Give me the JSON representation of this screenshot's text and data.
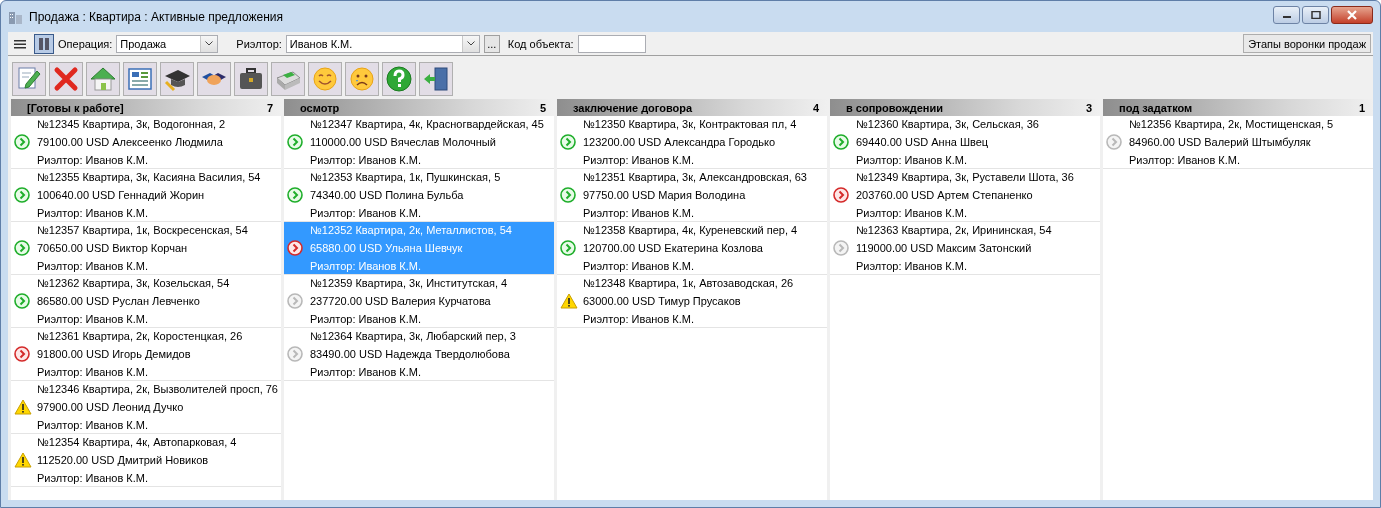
{
  "window": {
    "title": "Продажа : Квартира : Активные предложения"
  },
  "view_toggle": [
    {
      "kind": "list",
      "selected": false
    },
    {
      "kind": "columns",
      "selected": true
    }
  ],
  "filters": {
    "operation_label": "Операция:",
    "operation_value": "Продажа",
    "realtor_label": "Риэлтор:",
    "realtor_value": "Иванов К.М.",
    "browse_button": "...",
    "code_label": "Код объекта:"
  },
  "funnel_button": "Этапы воронки продаж",
  "toolbar": [
    {
      "kind": "edit"
    },
    {
      "kind": "delete"
    },
    {
      "kind": "home"
    },
    {
      "kind": "form"
    },
    {
      "kind": "cap"
    },
    {
      "kind": "handshake"
    },
    {
      "kind": "briefcase"
    },
    {
      "kind": "printer"
    },
    {
      "kind": "smile"
    },
    {
      "kind": "sad"
    },
    {
      "kind": "help"
    },
    {
      "kind": "exit"
    }
  ],
  "columns": [
    {
      "title": "[Готовы к работе]",
      "count": "7",
      "cards": [
        {
          "kind": "go",
          "selected": false,
          "lines": [
            "№12345 Квартира, 3к, Водогонная, 2",
            "79100.00 USD Алексеенко Людмила",
            "Риэлтор: Иванов К.М."
          ]
        },
        {
          "kind": "go",
          "selected": false,
          "lines": [
            "№12355 Квартира, 3к, Касияна Василия, 54",
            "100640.00 USD Геннадий Жорин",
            "Риэлтор: Иванов К.М."
          ]
        },
        {
          "kind": "go",
          "selected": false,
          "lines": [
            "№12357 Квартира, 1к, Воскресенская, 54",
            "70650.00 USD Виктор Корчан",
            "Риэлтор: Иванов К.М."
          ]
        },
        {
          "kind": "go",
          "selected": false,
          "lines": [
            "№12362 Квартира, 3к, Козельская, 54",
            "86580.00 USD Руслан Левченко",
            "Риэлтор: Иванов К.М."
          ]
        },
        {
          "kind": "stop",
          "selected": false,
          "lines": [
            "№12361 Квартира, 2к, Коростенцкая, 26",
            "91800.00 USD Игорь Демидов",
            "Риэлтор: Иванов К.М."
          ]
        },
        {
          "kind": "warn",
          "selected": false,
          "lines": [
            "№12346 Квартира, 2к, Вызволителей просп, 76",
            "97900.00 USD Леонид Дучко",
            "Риэлтор: Иванов К.М."
          ]
        },
        {
          "kind": "warn",
          "selected": false,
          "lines": [
            "№12354 Квартира, 4к, Автопарковая, 4",
            "112520.00 USD Дмитрий Новиков",
            "Риэлтор: Иванов К.М."
          ]
        }
      ]
    },
    {
      "title": "осмотр",
      "count": "5",
      "cards": [
        {
          "kind": "go",
          "selected": false,
          "lines": [
            "№12347 Квартира, 4к, Красногвардейская, 45",
            "110000.00 USD Вячеслав Молочный",
            "Риэлтор: Иванов К.М."
          ]
        },
        {
          "kind": "go",
          "selected": false,
          "lines": [
            "№12353 Квартира, 1к, Пушкинская, 5",
            "74340.00 USD Полина Бульба",
            "Риэлтор: Иванов К.М."
          ]
        },
        {
          "kind": "stop",
          "selected": true,
          "lines": [
            "№12352 Квартира, 2к, Металлистов, 54",
            "65880.00 USD Ульяна Шевчук",
            "Риэлтор: Иванов К.М."
          ]
        },
        {
          "kind": "idle",
          "selected": false,
          "lines": [
            "№12359 Квартира, 3к, Институтская, 4",
            "237720.00 USD Валерия Курчатова",
            "Риэлтор: Иванов К.М."
          ]
        },
        {
          "kind": "idle",
          "selected": false,
          "lines": [
            "№12364 Квартира, 3к, Любарский пер, 3",
            "83490.00 USD Надежда Твердолюбова",
            "Риэлтор: Иванов К.М."
          ]
        }
      ]
    },
    {
      "title": "заключение договора",
      "count": "4",
      "cards": [
        {
          "kind": "go",
          "selected": false,
          "lines": [
            "№12350 Квартира, 3к, Контрактовая пл, 4",
            "123200.00 USD Александра Городько",
            "Риэлтор: Иванов К.М."
          ]
        },
        {
          "kind": "go",
          "selected": false,
          "lines": [
            "№12351 Квартира, 3к, Александровская, 63",
            "97750.00 USD Мария Володина",
            "Риэлтор: Иванов К.М."
          ]
        },
        {
          "kind": "go",
          "selected": false,
          "lines": [
            "№12358 Квартира, 4к, Куреневский пер, 4",
            "120700.00 USD Екатерина Козлова",
            "Риэлтор: Иванов К.М."
          ]
        },
        {
          "kind": "warn",
          "selected": false,
          "lines": [
            "№12348 Квартира, 1к, Автозаводская, 26",
            "63000.00 USD Тимур Прусаков",
            "Риэлтор: Иванов К.М."
          ]
        }
      ]
    },
    {
      "title": "в сопровождении",
      "count": "3",
      "cards": [
        {
          "kind": "go",
          "selected": false,
          "lines": [
            "№12360 Квартира, 3к, Сельская, 36",
            "69440.00 USD Анна Швец",
            "Риэлтор: Иванов К.М."
          ]
        },
        {
          "kind": "stop",
          "selected": false,
          "lines": [
            "№12349 Квартира, 3к, Руставели Шота, 36",
            "203760.00 USD Артем Степаненко",
            "Риэлтор: Иванов К.М."
          ]
        },
        {
          "kind": "idle",
          "selected": false,
          "lines": [
            "№12363 Квартира, 2к, Ирининская, 54",
            "119000.00 USD Максим Затонский",
            "Риэлтор: Иванов К.М."
          ]
        }
      ]
    },
    {
      "title": "под задатком",
      "count": "1",
      "cards": [
        {
          "kind": "idle",
          "selected": false,
          "lines": [
            "№12356 Квартира, 2к, Мостищенская, 5",
            "84960.00 USD Валерий Штымбуляк",
            "Риэлтор: Иванов К.М."
          ]
        }
      ]
    }
  ]
}
